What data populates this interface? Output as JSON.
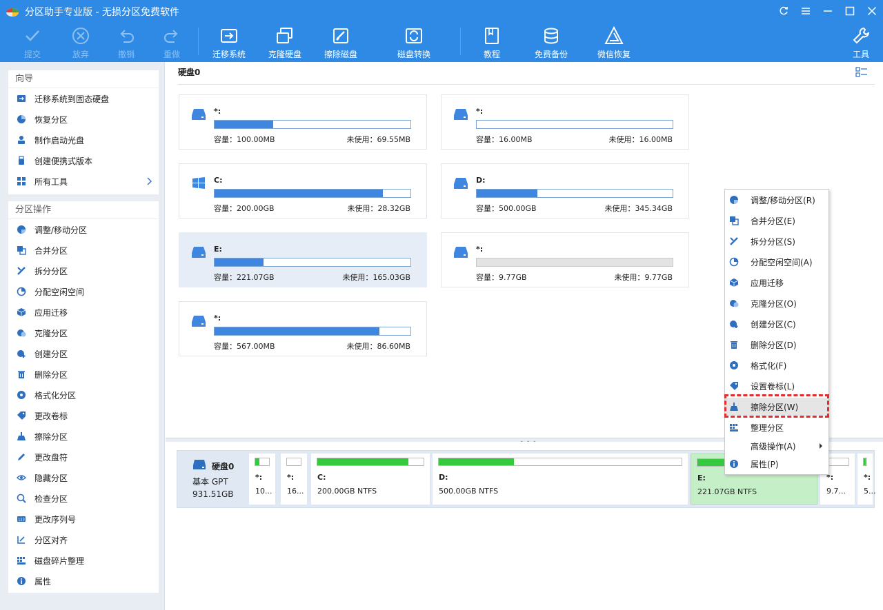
{
  "window": {
    "title": "分区助手专业版 - 无损分区免费软件"
  },
  "toolbar": {
    "commit": "提交",
    "discard": "放弃",
    "undo": "撤销",
    "redo": "重做",
    "migrate_os": "迁移系统",
    "clone_disk": "克隆硬盘",
    "wipe_disk": "擦除磁盘",
    "disk_convert": "磁盘转换",
    "tutorial": "教程",
    "free_backup": "免费备份",
    "wechat_recovery": "微信恢复",
    "tools": "工具"
  },
  "wizard": {
    "title": "向导",
    "items": [
      "迁移系统到固态硬盘",
      "恢复分区",
      "制作启动光盘",
      "创建便携式版本",
      "所有工具"
    ]
  },
  "ops": {
    "title": "分区操作",
    "items": [
      "调整/移动分区",
      "合并分区",
      "拆分分区",
      "分配空闲空间",
      "应用迁移",
      "克隆分区",
      "创建分区",
      "删除分区",
      "格式化分区",
      "更改卷标",
      "擦除分区",
      "更改盘符",
      "隐藏分区",
      "检查分区",
      "更改序列号",
      "分区对齐",
      "磁盘碎片整理",
      "属性"
    ]
  },
  "main": {
    "disk_title": "硬盘0",
    "cap_label": "容量：",
    "free_label": "未使用：",
    "partitions": [
      {
        "name": "*:",
        "capacity": "100.00MB",
        "free": "69.55MB",
        "used_ratio": 0.3
      },
      {
        "name": "*:",
        "capacity": "16.00MB",
        "free": "16.00MB",
        "used_ratio": 0.0
      },
      {
        "name": "C:",
        "capacity": "200.00GB",
        "free": "28.32GB",
        "used_ratio": 0.86,
        "icon": "windows-icon"
      },
      {
        "name": "D:",
        "capacity": "500.00GB",
        "free": "345.34GB",
        "used_ratio": 0.31
      },
      {
        "name": "E:",
        "capacity": "221.07GB",
        "free": "165.03GB",
        "used_ratio": 0.25,
        "selected": true
      },
      {
        "name": "*:",
        "capacity": "9.77GB",
        "free": "9.77GB",
        "used_ratio": 0.0,
        "unallocated": true
      },
      {
        "name": "*:",
        "capacity": "567.00MB",
        "free": "86.60MB",
        "used_ratio": 0.84
      }
    ]
  },
  "diskmap": {
    "name": "硬盘0",
    "type": "基本 GPT",
    "size": "931.51GB",
    "segments": [
      {
        "name": "*:",
        "desc": "10...",
        "used_ratio": 0.3
      },
      {
        "name": "*:",
        "desc": "16...",
        "used_ratio": 0.0
      },
      {
        "name": "C:",
        "desc": "200.00GB NTFS",
        "used_ratio": 0.86
      },
      {
        "name": "D:",
        "desc": "500.00GB NTFS",
        "used_ratio": 0.31
      },
      {
        "name": "E:",
        "desc": "221.07GB NTFS",
        "used_ratio": 0.25,
        "selected": true
      },
      {
        "name": "*:",
        "desc": "9.7...",
        "used_ratio": 0.0
      },
      {
        "name": "*:",
        "desc": "5...",
        "used_ratio": 0.84
      }
    ]
  },
  "context_menu": {
    "items": [
      "调整/移动分区(R)",
      "合并分区(E)",
      "拆分分区(S)",
      "分配空闲空间(A)",
      "应用迁移",
      "克隆分区(O)",
      "创建分区(C)",
      "删除分区(D)",
      "格式化(F)",
      "设置卷标(L)",
      "擦除分区(W)",
      "整理分区",
      "高级操作(A)",
      "属性(P)"
    ],
    "highlighted": "擦除分区(W)"
  },
  "colors": {
    "header": "#2f8ae5",
    "bar_fill": "#3f86e0",
    "map_fill": "#35c93d",
    "highlight_border": "#e32d2d"
  }
}
